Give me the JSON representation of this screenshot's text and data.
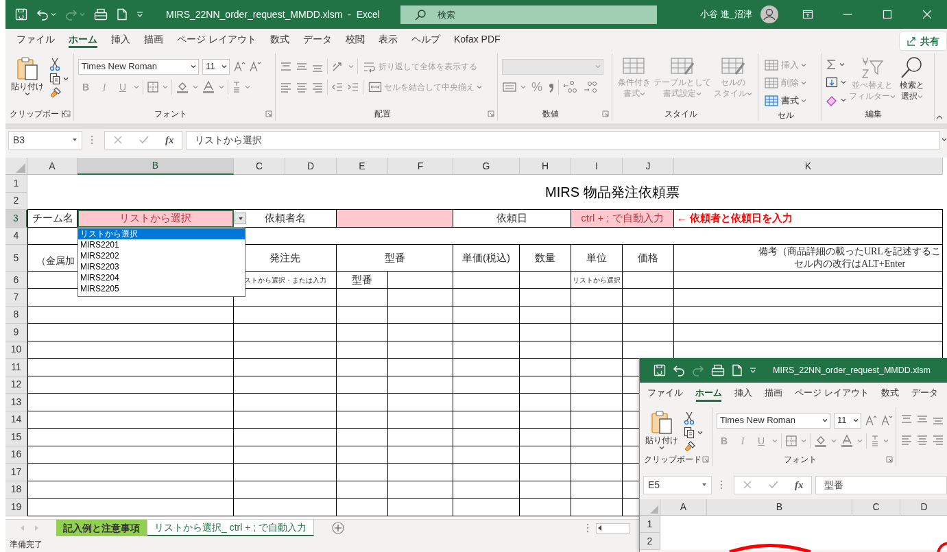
{
  "window": {
    "title": "MIRS_22NN_order_request_MMDD.xlsm  -  Excel",
    "search_placeholder": "検索",
    "user": "小谷 進_沼津"
  },
  "ribbon_tabs": [
    {
      "label": "ファイル",
      "selected": false
    },
    {
      "label": "ホーム",
      "selected": true
    },
    {
      "label": "挿入",
      "selected": false
    },
    {
      "label": "描画",
      "selected": false
    },
    {
      "label": "ページ レイアウト",
      "selected": false
    },
    {
      "label": "数式",
      "selected": false
    },
    {
      "label": "データ",
      "selected": false
    },
    {
      "label": "校閲",
      "selected": false
    },
    {
      "label": "表示",
      "selected": false
    },
    {
      "label": "ヘルプ",
      "selected": false
    },
    {
      "label": "Kofax PDF",
      "selected": false
    }
  ],
  "share_button": "共有",
  "ribbon_groups": [
    {
      "kind": "clipboard",
      "label": "クリップボード",
      "launcher": true,
      "paste": "貼り付け"
    },
    {
      "kind": "font",
      "label": "フォント",
      "launcher": true,
      "font_name": "Times New Roman",
      "font_size": "11",
      "style_buttons": [
        {
          "label": "B",
          "disabled": true
        },
        {
          "label": "I",
          "disabled": true
        },
        {
          "label": "U",
          "disabled": true
        }
      ]
    },
    {
      "kind": "alignment",
      "label": "配置",
      "launcher": true,
      "buttons": [
        {
          "label": "折り返して全体を表示する",
          "disabled": true
        },
        {
          "label": "セルを結合して中央揃え",
          "disabled": true
        }
      ]
    },
    {
      "kind": "number",
      "label": "数値",
      "launcher": true,
      "buttons": [
        {
          "label": "%",
          "disabled": true
        }
      ]
    },
    {
      "kind": "styles",
      "label": "スタイル",
      "launcher": false,
      "buttons": [
        {
          "lines": [
            "条件付き",
            "書式"
          ],
          "disabled": true
        },
        {
          "lines": [
            "テーブルとして",
            "書式設定"
          ],
          "disabled": true
        },
        {
          "lines": [
            "セルの",
            "スタイル"
          ],
          "disabled": true
        }
      ]
    },
    {
      "kind": "cells",
      "label": "セル",
      "launcher": false,
      "buttons": [
        {
          "label": "挿入",
          "disabled": true
        },
        {
          "label": "削除",
          "disabled": true
        },
        {
          "label": "書式",
          "disabled": false
        }
      ]
    },
    {
      "kind": "editing",
      "label": "編集",
      "launcher": false,
      "buttons": [
        {
          "lines": [
            "並べ替えと",
            "フィルター"
          ],
          "disabled": true
        },
        {
          "lines": [
            "検索と",
            "選択"
          ],
          "disabled": false
        }
      ]
    }
  ],
  "formula_bar": {
    "name_box": "B3",
    "fx": "fx",
    "formula": "リストから選択"
  },
  "sheet": {
    "columns": [
      {
        "label": "A",
        "selected": false
      },
      {
        "label": "B",
        "selected": true
      },
      {
        "label": "C",
        "selected": false
      },
      {
        "label": "D",
        "selected": false
      },
      {
        "label": "E",
        "selected": false
      },
      {
        "label": "F",
        "selected": false
      },
      {
        "label": "G",
        "selected": false
      },
      {
        "label": "H",
        "selected": false
      },
      {
        "label": "I",
        "selected": false
      },
      {
        "label": "J",
        "selected": false
      },
      {
        "label": "K",
        "selected": false
      }
    ],
    "rows": [
      {
        "header": "1",
        "selected": false,
        "cells": [
          {
            "kind": "title",
            "text": "MIRS  物品発注依頼票"
          }
        ]
      },
      {
        "header": "2",
        "selected": false
      },
      {
        "header": "3",
        "selected": true,
        "cells": [
          {
            "kind": "label",
            "text": "チーム名"
          },
          {
            "kind": "input",
            "text": "リストから選択"
          },
          {
            "kind": "label",
            "text": "依頼者名"
          },
          {
            "kind": "input"
          },
          {
            "kind": "label",
            "text": "依頼日"
          },
          {
            "kind": "input",
            "text": "ctrl + ; で自動入力"
          },
          {
            "kind": "note",
            "text": "← 依頼者と依頼日を入力"
          }
        ]
      },
      {
        "header": "4",
        "selected": false
      },
      {
        "header": "5",
        "selected": false,
        "cells": [
          {
            "kind": "partial",
            "text": "（金属加"
          },
          {
            "kind": "label",
            "text": "発注先"
          },
          {
            "kind": "label",
            "text": "型番"
          },
          {
            "kind": "label",
            "text": "単価(税込)"
          },
          {
            "kind": "label",
            "text": "数量"
          },
          {
            "kind": "label",
            "text": "単位"
          },
          {
            "kind": "label",
            "text": "価格"
          },
          {
            "kind": "remark",
            "lines": [
              "備考（商品詳細の載ったURLを記述するこ",
              "セル内の改行はALT+Enter"
            ]
          }
        ]
      },
      {
        "header": "6",
        "selected": false,
        "cells": [
          {
            "kind": "empty"
          },
          {
            "kind": "small",
            "text": "ストから選択・または入力"
          },
          {
            "kind": "label",
            "text": "型番"
          },
          {
            "kind": "empty"
          },
          {
            "kind": "empty"
          },
          {
            "kind": "empty"
          },
          {
            "kind": "small",
            "text": "リストから選択"
          }
        ]
      },
      {
        "header": "7",
        "selected": false
      },
      {
        "header": "8",
        "selected": false
      },
      {
        "header": "9",
        "selected": false
      },
      {
        "header": "10",
        "selected": false
      },
      {
        "header": "11",
        "selected": false
      },
      {
        "header": "12",
        "selected": false
      },
      {
        "header": "13",
        "selected": false
      },
      {
        "header": "14",
        "selected": false
      },
      {
        "header": "15",
        "selected": false
      },
      {
        "header": "16",
        "selected": false
      },
      {
        "header": "17",
        "selected": false
      },
      {
        "header": "18",
        "selected": false
      },
      {
        "header": "19",
        "selected": false
      }
    ]
  },
  "dropdown": {
    "items": [
      {
        "label": "リストから選択",
        "selected": true
      },
      {
        "label": "MIRS2201",
        "selected": false
      },
      {
        "label": "MIRS2202",
        "selected": false
      },
      {
        "label": "MIRS2203",
        "selected": false
      },
      {
        "label": "MIRS2204",
        "selected": false
      },
      {
        "label": "MIRS2205",
        "selected": false
      }
    ]
  },
  "sheet_tabs": [
    {
      "label": "記入例と注意事項",
      "selected": false,
      "color": "#92d050"
    },
    {
      "label": "リストから選択_ ctrl + ; で自動入力",
      "selected": true
    }
  ],
  "status_bar": "準備完了",
  "second_window": {
    "title": "MIRS_22NN_order_request_MMDD.xlsm",
    "tabs": [
      {
        "label": "ファイル",
        "selected": false
      },
      {
        "label": "ホーム",
        "selected": true
      },
      {
        "label": "挿入",
        "selected": false
      },
      {
        "label": "描画",
        "selected": false
      },
      {
        "label": "ページ レイアウト",
        "selected": false
      },
      {
        "label": "数式",
        "selected": false
      },
      {
        "label": "データ",
        "selected": false
      }
    ],
    "paste": "貼り付け",
    "font_name": "Times New Roman",
    "font_size": "11",
    "style_buttons": [
      {
        "label": "B",
        "disabled": true
      },
      {
        "label": "I",
        "disabled": true
      },
      {
        "label": "U",
        "disabled": true
      }
    ],
    "group_labels": [
      "クリップボード",
      "フォント"
    ],
    "name_box": "E5",
    "fx": "fx",
    "formula": "型番",
    "columns": [
      "A",
      "B",
      "C",
      "D"
    ],
    "rows": [
      "1",
      "2"
    ]
  }
}
